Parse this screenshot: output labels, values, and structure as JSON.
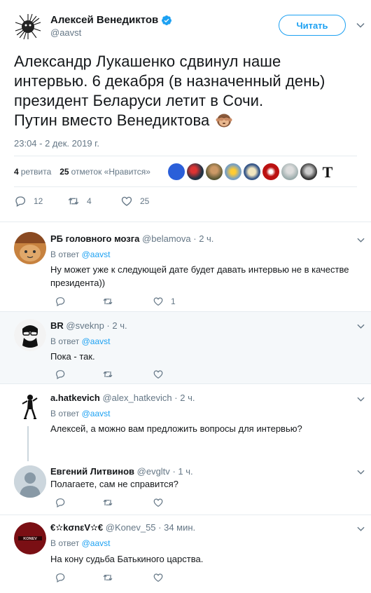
{
  "main_tweet": {
    "author_name": "Алексей Венедиктов",
    "author_handle": "@aavst",
    "follow_label": "Читать",
    "text_lines": [
      "Александр Лукашенко сдвинул наше",
      "интервью. 6 декабря (в назначенный день)",
      "президент Беларуси летит в Сочи.",
      "Путин вместо Венедиктова"
    ],
    "timestamp": "23:04 - 2 дек. 2019 г.",
    "retweets_count": "4",
    "retweets_label": "ретвита",
    "likes_count": "25",
    "likes_label": "отметок «Нравится»",
    "actions": {
      "replies": "12",
      "retweets": "4",
      "likes": "25"
    }
  },
  "replies": [
    {
      "name": "РБ головного мозга",
      "handle": "@belamova",
      "time": "· 2 ч.",
      "in_reply_prefix": "В ответ",
      "in_reply_to": "@aavst",
      "text": "Ну может уже к следующей дате будет давать интервью не в качестве президента))",
      "likes": "1"
    },
    {
      "name": "BR",
      "handle": "@sveknp",
      "time": "· 2 ч.",
      "in_reply_prefix": "В ответ",
      "in_reply_to": "@aavst",
      "text": "Пока - так.",
      "likes": ""
    },
    {
      "name": "a.hatkevich",
      "handle": "@alex_hatkevich",
      "time": "· 2 ч.",
      "in_reply_prefix": "В ответ",
      "in_reply_to": "@aavst",
      "text": "Алексей, а можно вам предложить вопросы для интервью?",
      "likes": ""
    },
    {
      "name": "Евгений Литвинов",
      "handle": "@evgltv",
      "time": "· 1 ч.",
      "text": "Полагаете, сам не справится?",
      "likes": ""
    },
    {
      "name": "€✫kσnεV✫€",
      "handle": "@Konev_55",
      "time": "· 34 мин.",
      "in_reply_prefix": "В ответ",
      "in_reply_to": "@aavst",
      "text": "На кону судьба Батькиного царства.",
      "likes": "",
      "avatar_text": "KONEV"
    }
  ],
  "colors": {
    "accent": "#1da1f2",
    "secondary_text": "#657786",
    "border": "#e6ecf0",
    "hover_bg": "#f5f8fa"
  },
  "icons": [
    "verified-badge-icon",
    "chevron-down-icon",
    "reply-icon",
    "retweet-icon",
    "like-icon",
    "monkey-emoji-icon"
  ]
}
